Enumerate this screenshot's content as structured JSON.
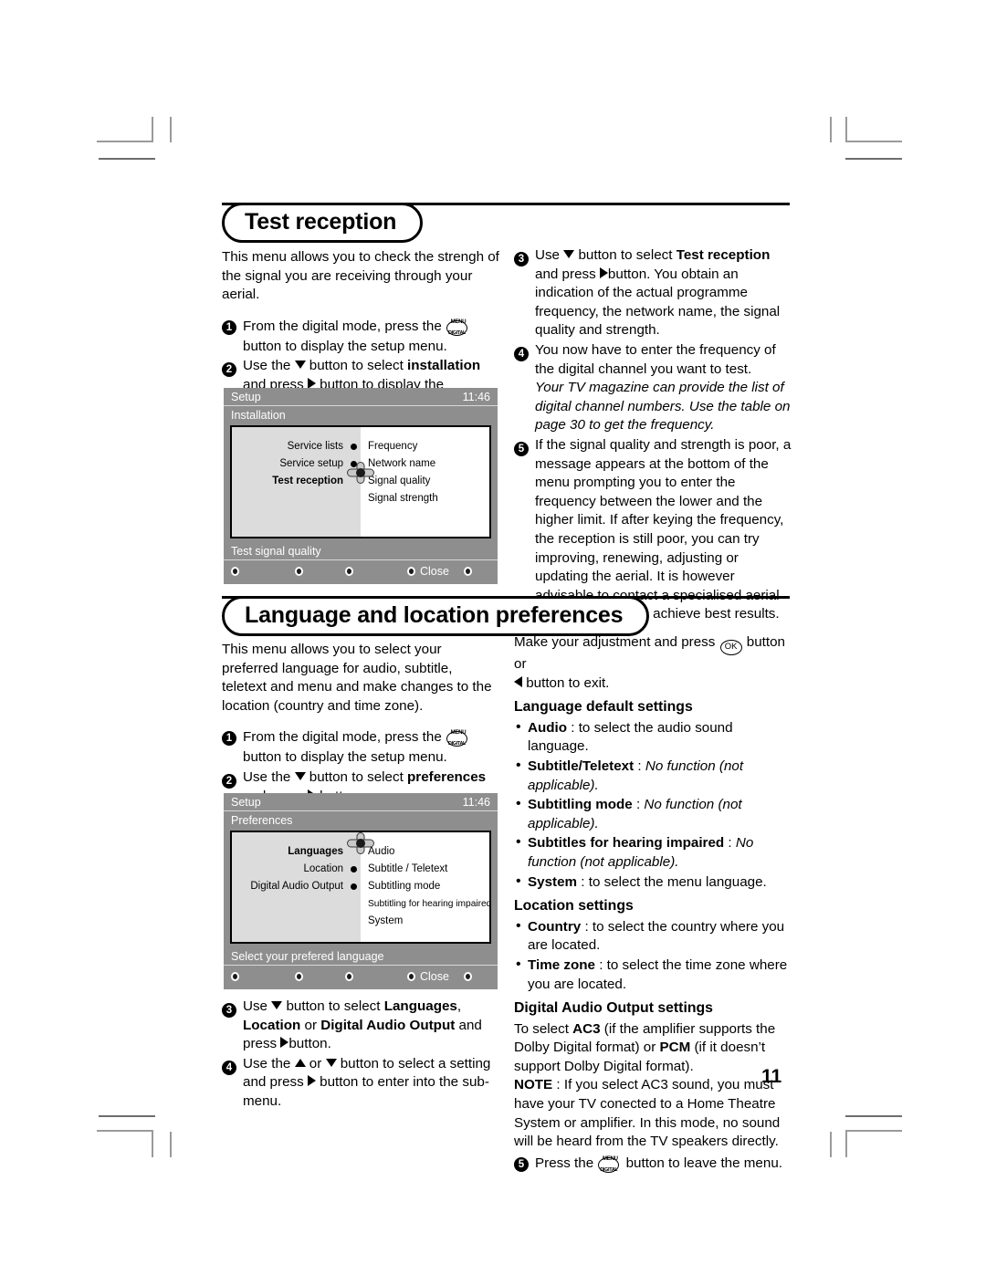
{
  "page": {
    "number": "11"
  },
  "sections": [
    {
      "id": "test-reception",
      "heading": "Test reception"
    },
    {
      "id": "language-location",
      "heading": "Language and location preferences"
    }
  ],
  "test_reception": {
    "intro": "This menu allows you to check the strengh of the signal you are receiving through your aerial.",
    "steps": [
      {
        "num": "1",
        "parts": [
          {
            "t": "text",
            "v": "From the digital mode, press the "
          },
          {
            "t": "icon",
            "v": "digital-menu-button"
          },
          {
            "t": "text",
            "v": " button to display the setup menu."
          }
        ]
      },
      {
        "num": "2",
        "parts": [
          {
            "t": "text",
            "v": "Use the "
          },
          {
            "t": "icon",
            "v": "triangle-down"
          },
          {
            "t": "text",
            "v": " button to select "
          },
          {
            "t": "bold",
            "v": "installation"
          },
          {
            "t": "text",
            "v": " and press "
          },
          {
            "t": "icon",
            "v": "triangle-right"
          },
          {
            "t": "text",
            "v": " button to display the installation menu."
          }
        ]
      },
      {
        "num": "3",
        "parts": [
          {
            "t": "text",
            "v": "Use "
          },
          {
            "t": "icon",
            "v": "triangle-down"
          },
          {
            "t": "text",
            "v": " button to select "
          },
          {
            "t": "bold",
            "v": "Test reception"
          },
          {
            "t": "text",
            "v": " and press "
          },
          {
            "t": "icon",
            "v": "triangle-right"
          },
          {
            "t": "text",
            "v": "button. You obtain an indication of the actual programme frequency, the network name, the signal quality and strength."
          }
        ]
      },
      {
        "num": "4",
        "parts": [
          {
            "t": "text",
            "v": "You now have to enter the frequency of the digital channel you want to test."
          },
          {
            "t": "break",
            "v": ""
          },
          {
            "t": "italic",
            "v": "Your TV magazine can provide the list of digital channel numbers. Use the table on page 30 to get the frequency."
          }
        ]
      },
      {
        "num": "5",
        "parts": [
          {
            "t": "text",
            "v": "If the signal quality and strength is poor, a message appears at the bottom of the menu prompting you to enter the frequency between the lower and the higher limit. If after keying the frequency, the reception is still poor, you can try improving, renewing, adjusting or updating the aerial. It is however advisable to contact a specialised aerial installer in order to achieve best results."
          }
        ]
      }
    ],
    "tv_menu": {
      "title": "Setup",
      "clock": "11:46",
      "subtitle": "Installation",
      "left_items": [
        {
          "label": "Service lists",
          "selected": false
        },
        {
          "label": "Service setup",
          "selected": false
        },
        {
          "label": "Test reception",
          "selected": true
        }
      ],
      "right_items": [
        "Frequency",
        "Network name",
        "Signal quality",
        "Signal strength"
      ],
      "status": "Test signal quality",
      "close_label": "Close"
    }
  },
  "language_location": {
    "intro": "This menu allows you to select your preferred language for audio, subtitle, teletext and menu and make changes to the location (country and time zone).",
    "steps": [
      {
        "num": "1",
        "parts": [
          {
            "t": "text",
            "v": "From the digital mode, press the "
          },
          {
            "t": "icon",
            "v": "digital-menu-button"
          },
          {
            "t": "text",
            "v": " button to display the setup menu."
          }
        ]
      },
      {
        "num": "2",
        "parts": [
          {
            "t": "text",
            "v": "Use the "
          },
          {
            "t": "icon",
            "v": "triangle-down"
          },
          {
            "t": "text",
            "v": " button to select "
          },
          {
            "t": "bold",
            "v": "preferences"
          },
          {
            "t": "text",
            "v": " and press "
          },
          {
            "t": "icon",
            "v": "triangle-right"
          },
          {
            "t": "text",
            "v": " button."
          }
        ]
      },
      {
        "num": "3",
        "parts": [
          {
            "t": "text",
            "v": "Use "
          },
          {
            "t": "icon",
            "v": "triangle-down"
          },
          {
            "t": "text",
            "v": " button to select "
          },
          {
            "t": "bold",
            "v": "Languages"
          },
          {
            "t": "text",
            "v": ", "
          },
          {
            "t": "bold",
            "v": "Location"
          },
          {
            "t": "text",
            "v": " or "
          },
          {
            "t": "bold",
            "v": "Digital Audio Output"
          },
          {
            "t": "text",
            "v": " and press "
          },
          {
            "t": "icon",
            "v": "triangle-right"
          },
          {
            "t": "text",
            "v": "button."
          }
        ]
      },
      {
        "num": "4",
        "parts": [
          {
            "t": "text",
            "v": "Use the "
          },
          {
            "t": "icon",
            "v": "triangle-up"
          },
          {
            "t": "text",
            "v": " or "
          },
          {
            "t": "icon",
            "v": "triangle-down"
          },
          {
            "t": "text",
            "v": " button to select a setting and press "
          },
          {
            "t": "icon",
            "v": "triangle-right"
          },
          {
            "t": "text",
            "v": " button to enter into the sub-menu."
          }
        ]
      },
      {
        "num": "5",
        "parts": [
          {
            "t": "text",
            "v": "Press the "
          },
          {
            "t": "icon",
            "v": "digital-menu-button"
          },
          {
            "t": "text",
            "v": " button to leave the menu."
          }
        ]
      }
    ],
    "adjust_note": {
      "pre": "Make your adjustment and press ",
      "ok_icon": "ok-button",
      "mid": " button or ",
      "left_icon": "triangle-left",
      "post": " button to exit."
    },
    "language_defaults": {
      "heading": "Language default settings",
      "items": [
        {
          "term": "Audio",
          "sep": " : ",
          "desc": "to select the audio sound language.",
          "italic": false
        },
        {
          "term": "Subtitle/Teletext",
          "sep": " : ",
          "desc": "No function (not applicable).",
          "italic": true
        },
        {
          "term": "Subtitling mode",
          "sep": " : ",
          "desc": "No function (not applicable).",
          "italic": true
        },
        {
          "term": "Subtitles for hearing impaired",
          "sep": " : ",
          "desc": "No function (not applicable).",
          "italic": true
        },
        {
          "term": "System",
          "sep": " : ",
          "desc": "to select the menu language.",
          "italic": false
        }
      ]
    },
    "location_settings": {
      "heading": "Location settings",
      "items": [
        {
          "term": "Country",
          "sep": " : ",
          "desc": "to select the country where you are located.",
          "italic": false
        },
        {
          "term": "Time zone",
          "sep": " : ",
          "desc": "to select the time zone where you are located.",
          "italic": false
        }
      ]
    },
    "digital_audio": {
      "heading": "Digital Audio Output settings",
      "body_1_pre": "To select ",
      "body_1_b1": "AC3",
      "body_1_mid": " (if the amplifier supports the Dolby Digital format) or ",
      "body_1_b2": "PCM",
      "body_1_post": " (if it doesn’t support Dolby Digital format).",
      "note_label": "NOTE",
      "note_body": " : If you select AC3 sound, you must have your TV conected to a Home Theatre System or amplifier. In this mode, no sound will be heard from the TV speakers directly."
    },
    "tv_menu": {
      "title": "Setup",
      "clock": "11:46",
      "subtitle": "Preferences",
      "left_items": [
        {
          "label": "Languages",
          "selected": true
        },
        {
          "label": "Location",
          "selected": false
        },
        {
          "label": "Digital Audio Output",
          "selected": false
        }
      ],
      "right_items": [
        "Audio",
        "Subtitle / Teletext",
        "Subtitling mode",
        "Subtitling for hearing impaired",
        "System"
      ],
      "status": "Select your prefered language",
      "close_label": "Close"
    }
  }
}
